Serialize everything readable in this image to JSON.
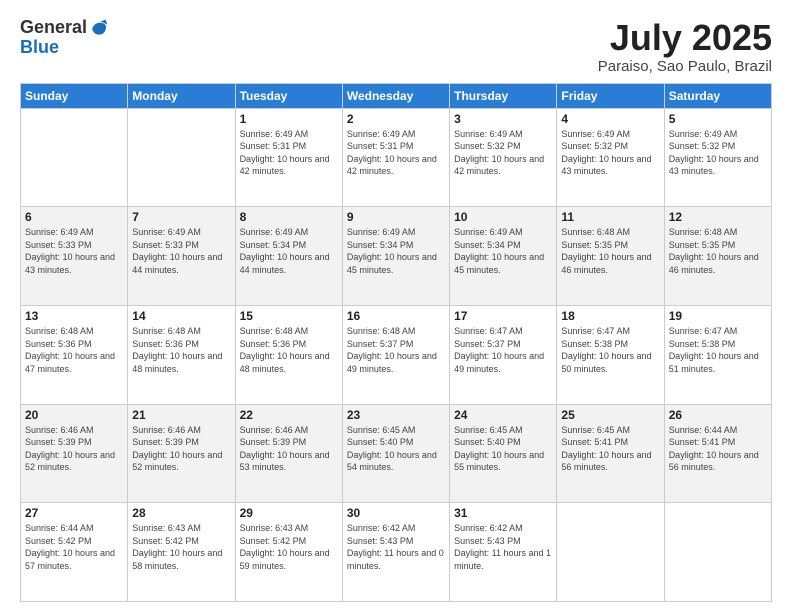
{
  "logo": {
    "general": "General",
    "blue": "Blue"
  },
  "title": {
    "month": "July 2025",
    "location": "Paraiso, Sao Paulo, Brazil"
  },
  "headers": [
    "Sunday",
    "Monday",
    "Tuesday",
    "Wednesday",
    "Thursday",
    "Friday",
    "Saturday"
  ],
  "weeks": [
    [
      {
        "day": "",
        "sunrise": "",
        "sunset": "",
        "daylight": ""
      },
      {
        "day": "",
        "sunrise": "",
        "sunset": "",
        "daylight": ""
      },
      {
        "day": "1",
        "sunrise": "Sunrise: 6:49 AM",
        "sunset": "Sunset: 5:31 PM",
        "daylight": "Daylight: 10 hours and 42 minutes."
      },
      {
        "day": "2",
        "sunrise": "Sunrise: 6:49 AM",
        "sunset": "Sunset: 5:31 PM",
        "daylight": "Daylight: 10 hours and 42 minutes."
      },
      {
        "day": "3",
        "sunrise": "Sunrise: 6:49 AM",
        "sunset": "Sunset: 5:32 PM",
        "daylight": "Daylight: 10 hours and 42 minutes."
      },
      {
        "day": "4",
        "sunrise": "Sunrise: 6:49 AM",
        "sunset": "Sunset: 5:32 PM",
        "daylight": "Daylight: 10 hours and 43 minutes."
      },
      {
        "day": "5",
        "sunrise": "Sunrise: 6:49 AM",
        "sunset": "Sunset: 5:32 PM",
        "daylight": "Daylight: 10 hours and 43 minutes."
      }
    ],
    [
      {
        "day": "6",
        "sunrise": "Sunrise: 6:49 AM",
        "sunset": "Sunset: 5:33 PM",
        "daylight": "Daylight: 10 hours and 43 minutes."
      },
      {
        "day": "7",
        "sunrise": "Sunrise: 6:49 AM",
        "sunset": "Sunset: 5:33 PM",
        "daylight": "Daylight: 10 hours and 44 minutes."
      },
      {
        "day": "8",
        "sunrise": "Sunrise: 6:49 AM",
        "sunset": "Sunset: 5:34 PM",
        "daylight": "Daylight: 10 hours and 44 minutes."
      },
      {
        "day": "9",
        "sunrise": "Sunrise: 6:49 AM",
        "sunset": "Sunset: 5:34 PM",
        "daylight": "Daylight: 10 hours and 45 minutes."
      },
      {
        "day": "10",
        "sunrise": "Sunrise: 6:49 AM",
        "sunset": "Sunset: 5:34 PM",
        "daylight": "Daylight: 10 hours and 45 minutes."
      },
      {
        "day": "11",
        "sunrise": "Sunrise: 6:48 AM",
        "sunset": "Sunset: 5:35 PM",
        "daylight": "Daylight: 10 hours and 46 minutes."
      },
      {
        "day": "12",
        "sunrise": "Sunrise: 6:48 AM",
        "sunset": "Sunset: 5:35 PM",
        "daylight": "Daylight: 10 hours and 46 minutes."
      }
    ],
    [
      {
        "day": "13",
        "sunrise": "Sunrise: 6:48 AM",
        "sunset": "Sunset: 5:36 PM",
        "daylight": "Daylight: 10 hours and 47 minutes."
      },
      {
        "day": "14",
        "sunrise": "Sunrise: 6:48 AM",
        "sunset": "Sunset: 5:36 PM",
        "daylight": "Daylight: 10 hours and 48 minutes."
      },
      {
        "day": "15",
        "sunrise": "Sunrise: 6:48 AM",
        "sunset": "Sunset: 5:36 PM",
        "daylight": "Daylight: 10 hours and 48 minutes."
      },
      {
        "day": "16",
        "sunrise": "Sunrise: 6:48 AM",
        "sunset": "Sunset: 5:37 PM",
        "daylight": "Daylight: 10 hours and 49 minutes."
      },
      {
        "day": "17",
        "sunrise": "Sunrise: 6:47 AM",
        "sunset": "Sunset: 5:37 PM",
        "daylight": "Daylight: 10 hours and 49 minutes."
      },
      {
        "day": "18",
        "sunrise": "Sunrise: 6:47 AM",
        "sunset": "Sunset: 5:38 PM",
        "daylight": "Daylight: 10 hours and 50 minutes."
      },
      {
        "day": "19",
        "sunrise": "Sunrise: 6:47 AM",
        "sunset": "Sunset: 5:38 PM",
        "daylight": "Daylight: 10 hours and 51 minutes."
      }
    ],
    [
      {
        "day": "20",
        "sunrise": "Sunrise: 6:46 AM",
        "sunset": "Sunset: 5:39 PM",
        "daylight": "Daylight: 10 hours and 52 minutes."
      },
      {
        "day": "21",
        "sunrise": "Sunrise: 6:46 AM",
        "sunset": "Sunset: 5:39 PM",
        "daylight": "Daylight: 10 hours and 52 minutes."
      },
      {
        "day": "22",
        "sunrise": "Sunrise: 6:46 AM",
        "sunset": "Sunset: 5:39 PM",
        "daylight": "Daylight: 10 hours and 53 minutes."
      },
      {
        "day": "23",
        "sunrise": "Sunrise: 6:45 AM",
        "sunset": "Sunset: 5:40 PM",
        "daylight": "Daylight: 10 hours and 54 minutes."
      },
      {
        "day": "24",
        "sunrise": "Sunrise: 6:45 AM",
        "sunset": "Sunset: 5:40 PM",
        "daylight": "Daylight: 10 hours and 55 minutes."
      },
      {
        "day": "25",
        "sunrise": "Sunrise: 6:45 AM",
        "sunset": "Sunset: 5:41 PM",
        "daylight": "Daylight: 10 hours and 56 minutes."
      },
      {
        "day": "26",
        "sunrise": "Sunrise: 6:44 AM",
        "sunset": "Sunset: 5:41 PM",
        "daylight": "Daylight: 10 hours and 56 minutes."
      }
    ],
    [
      {
        "day": "27",
        "sunrise": "Sunrise: 6:44 AM",
        "sunset": "Sunset: 5:42 PM",
        "daylight": "Daylight: 10 hours and 57 minutes."
      },
      {
        "day": "28",
        "sunrise": "Sunrise: 6:43 AM",
        "sunset": "Sunset: 5:42 PM",
        "daylight": "Daylight: 10 hours and 58 minutes."
      },
      {
        "day": "29",
        "sunrise": "Sunrise: 6:43 AM",
        "sunset": "Sunset: 5:42 PM",
        "daylight": "Daylight: 10 hours and 59 minutes."
      },
      {
        "day": "30",
        "sunrise": "Sunrise: 6:42 AM",
        "sunset": "Sunset: 5:43 PM",
        "daylight": "Daylight: 11 hours and 0 minutes."
      },
      {
        "day": "31",
        "sunrise": "Sunrise: 6:42 AM",
        "sunset": "Sunset: 5:43 PM",
        "daylight": "Daylight: 11 hours and 1 minute."
      },
      {
        "day": "",
        "sunrise": "",
        "sunset": "",
        "daylight": ""
      },
      {
        "day": "",
        "sunrise": "",
        "sunset": "",
        "daylight": ""
      }
    ]
  ]
}
